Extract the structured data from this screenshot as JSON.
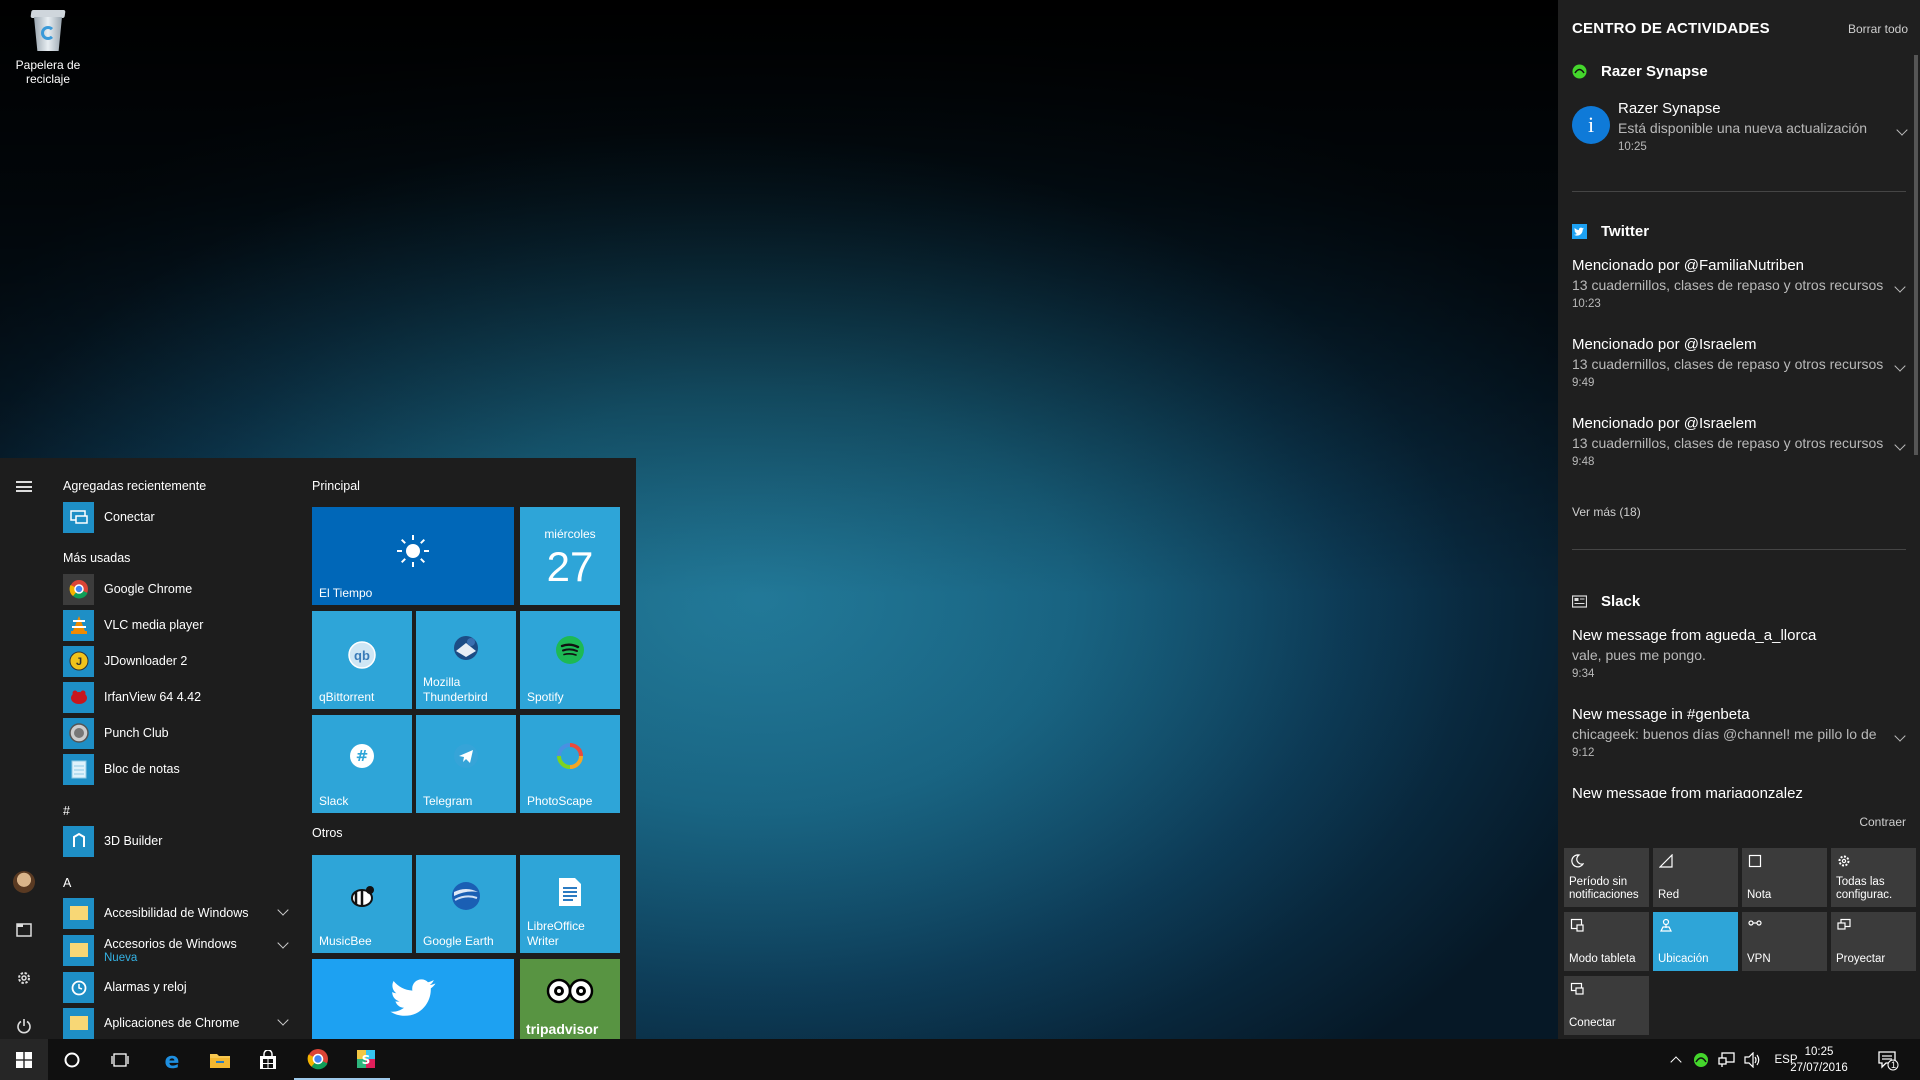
{
  "desktop": {
    "recycle_bin_label": "Papelera de reciclaje"
  },
  "start_menu": {
    "recent_header": "Agregadas recientemente",
    "recent": [
      {
        "label": "Conectar",
        "icon": "connect-icon"
      }
    ],
    "most_used_header": "Más usadas",
    "most_used": [
      {
        "label": "Google Chrome",
        "icon": "chrome-icon"
      },
      {
        "label": "VLC media player",
        "icon": "vlc-icon"
      },
      {
        "label": "JDownloader 2",
        "icon": "jdownloader-icon"
      },
      {
        "label": "IrfanView 64 4.42",
        "icon": "irfanview-icon"
      },
      {
        "label": "Punch Club",
        "icon": "punch-club-icon"
      },
      {
        "label": "Bloc de notas",
        "icon": "notepad-icon"
      }
    ],
    "hash_header": "#",
    "hash_items": [
      {
        "label": "3D Builder",
        "icon": "3d-builder-icon"
      }
    ],
    "a_header": "A",
    "a_items": [
      {
        "label": "Accesibilidad de Windows",
        "icon": "folder-icon",
        "expandable": true
      },
      {
        "label": "Accesorios de Windows",
        "sub": "Nueva",
        "icon": "folder-icon",
        "expandable": true
      },
      {
        "label": "Alarmas y reloj",
        "icon": "alarm-icon"
      },
      {
        "label": "Aplicaciones de Chrome",
        "icon": "folder-icon",
        "expandable": true
      }
    ],
    "group_principal": "Principal",
    "group_otros": "Otros",
    "tiles": {
      "weather": "El Tiempo",
      "calendar_day": "miércoles",
      "calendar_date": "27",
      "qbittorrent": "qBittorrent",
      "thunderbird": "Mozilla Thunderbird",
      "spotify": "Spotify",
      "slack": "Slack",
      "telegram": "Telegram",
      "photoscape": "PhotoScape",
      "musicbee": "MusicBee",
      "google_earth": "Google Earth",
      "libreoffice": "LibreOffice Writer",
      "tripadvisor": "tripadvisor"
    }
  },
  "action_center": {
    "title": "CENTRO DE ACTIVIDADES",
    "clear_all": "Borrar todo",
    "groups": {
      "razer": {
        "app": "Razer Synapse",
        "notifications": [
          {
            "title": "Razer Synapse",
            "body": "Está disponible una nueva actualización",
            "time": "10:25"
          }
        ]
      },
      "twitter": {
        "app": "Twitter",
        "notifications": [
          {
            "title": "Mencionado por @FamiliaNutriben",
            "body": "13 cuadernillos, clases de repaso y otros recursos",
            "time": "10:23"
          },
          {
            "title": "Mencionado por @Israelem",
            "body": "13 cuadernillos, clases de repaso y otros recursos",
            "time": "9:49"
          },
          {
            "title": "Mencionado por @Israelem",
            "body": "13 cuadernillos, clases de repaso y otros recursos",
            "time": "9:48"
          }
        ],
        "more": "Ver más (18)"
      },
      "slack": {
        "app": "Slack",
        "notifications": [
          {
            "title": "New message from agueda_a_llorca",
            "body": "vale, pues me pongo.",
            "time": "9:34"
          },
          {
            "title": "New message in #genbeta",
            "body": "chicageek: buenos días @channel! me pillo lo de",
            "time": "9:12"
          },
          {
            "title": "New message from mariagonzalez",
            "body": "",
            "time": ""
          }
        ]
      }
    },
    "collapse": "Contraer",
    "quick_actions": [
      {
        "label": "Período sin notificaciones",
        "icon": "moon-icon",
        "on": false
      },
      {
        "label": "Red",
        "icon": "network-icon",
        "on": false
      },
      {
        "label": "Nota",
        "icon": "note-icon",
        "on": false
      },
      {
        "label": "Todas las configurac.",
        "icon": "settings-icon",
        "on": false
      },
      {
        "label": "Modo tableta",
        "icon": "tablet-icon",
        "on": false
      },
      {
        "label": "Ubicación",
        "icon": "location-icon",
        "on": true
      },
      {
        "label": "VPN",
        "icon": "vpn-icon",
        "on": false
      },
      {
        "label": "Proyectar",
        "icon": "project-icon",
        "on": false
      },
      {
        "label": "Conectar",
        "icon": "connect-icon",
        "on": false
      }
    ]
  },
  "taskbar": {
    "language": "ESP",
    "time": "10:25",
    "date": "27/07/2016",
    "notification_count": "1"
  },
  "colors": {
    "accent": "#2ea5d8",
    "tile_blue": "#1e8fc6",
    "weather_tile": "#0067b8",
    "twitter_blue": "#1da1f2",
    "tripadvisor_green": "#589442"
  }
}
